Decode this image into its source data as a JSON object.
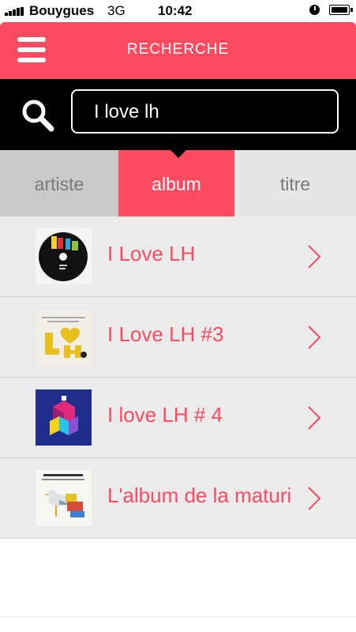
{
  "status_bar": {
    "carrier": "Bouygues",
    "network": "3G",
    "time": "10:42",
    "icons": [
      "signal-icon",
      "clock-icon",
      "battery-icon"
    ]
  },
  "header": {
    "title": "RECHERCHE",
    "menu_icon": "hamburger-menu-icon",
    "background": "#fc4a60"
  },
  "search": {
    "icon": "search-icon",
    "value": "I love lh"
  },
  "tabs": [
    {
      "label": "artiste",
      "selected": false
    },
    {
      "label": "album",
      "selected": true
    },
    {
      "label": "titre",
      "selected": false
    }
  ],
  "albums": [
    {
      "title": "I Love LH",
      "cover": "black-disc-cover"
    },
    {
      "title": "I Love LH #3",
      "cover": "yellow-letters-cover"
    },
    {
      "title": "I love LH # 4",
      "cover": "blue-cubes-cover"
    },
    {
      "title": "L'album de la maturi",
      "cover": "bird-cover"
    }
  ],
  "colors": {
    "accent": "#fc4a60",
    "list_bg": "#ebebeb",
    "search_bg": "#000000"
  }
}
